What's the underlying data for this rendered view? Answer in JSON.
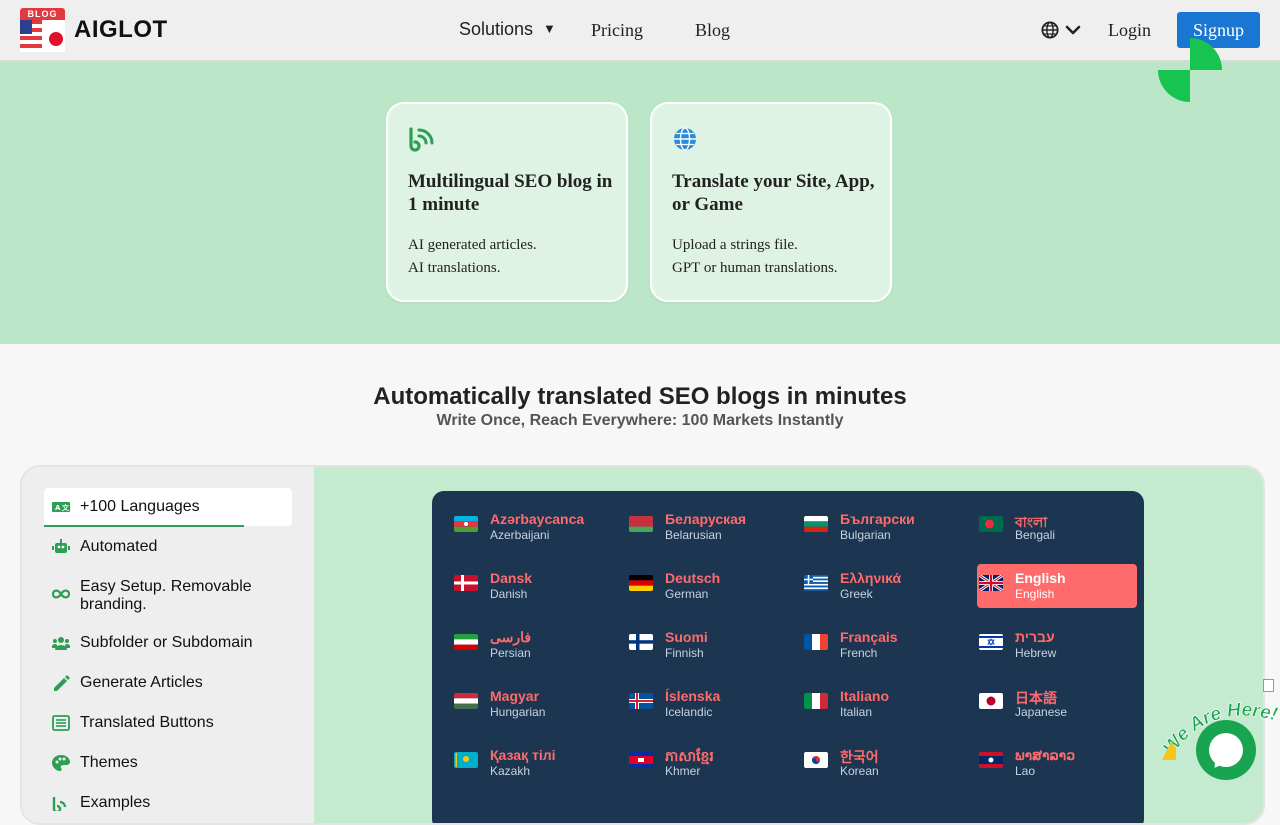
{
  "nav": {
    "logo_tag": "BLOG",
    "brand": "AIGLOT",
    "solutions": "Solutions",
    "solutions_caret": "▼",
    "pricing": "Pricing",
    "blog": "Blog",
    "login": "Login",
    "signup": "Signup",
    "icons": [
      "globe-icon",
      "chevron-down-icon"
    ]
  },
  "hero": {
    "cards": [
      {
        "icon": "blog-feed-icon",
        "title": "Multilingual SEO blog in 1 minute",
        "line1": "AI generated articles.",
        "line2": "AI translations."
      },
      {
        "icon": "globe-icon",
        "title": "Translate your Site, App, or Game",
        "line1": "Upload a strings file.",
        "line2": "GPT or human translations."
      }
    ]
  },
  "section": {
    "title": "Automatically translated SEO blogs in minutes",
    "subtitle": "Write Once, Reach Everywhere: 100 Markets Instantly"
  },
  "sidebar": {
    "items": [
      {
        "icon": "translate-icon",
        "label": "+100 Languages"
      },
      {
        "icon": "robot-icon",
        "label": "Automated"
      },
      {
        "icon": "infinity-icon",
        "label": "Easy Setup. Removable branding."
      },
      {
        "icon": "users-icon",
        "label": "Subfolder or Subdomain"
      },
      {
        "icon": "pencil-icon",
        "label": "Generate Articles"
      },
      {
        "icon": "list-icon",
        "label": "Translated Buttons"
      },
      {
        "icon": "palette-icon",
        "label": "Themes"
      },
      {
        "icon": "feed-icon",
        "label": "Examples"
      }
    ]
  },
  "languages": [
    {
      "native": "Azərbaycanca",
      "english": "Azerbaijani"
    },
    {
      "native": "Беларуская",
      "english": "Belarusian"
    },
    {
      "native": "Български",
      "english": "Bulgarian"
    },
    {
      "native": "বাংলা",
      "english": "Bengali"
    },
    {
      "native": "Dansk",
      "english": "Danish"
    },
    {
      "native": "Deutsch",
      "english": "German"
    },
    {
      "native": "Ελληνικά",
      "english": "Greek"
    },
    {
      "native": "English",
      "english": "English"
    },
    {
      "native": "فارسی",
      "english": "Persian"
    },
    {
      "native": "Suomi",
      "english": "Finnish"
    },
    {
      "native": "Français",
      "english": "French"
    },
    {
      "native": "עברית",
      "english": "Hebrew"
    },
    {
      "native": "Magyar",
      "english": "Hungarian"
    },
    {
      "native": "Íslenska",
      "english": "Icelandic"
    },
    {
      "native": "Italiano",
      "english": "Italian"
    },
    {
      "native": "日本語",
      "english": "Japanese"
    },
    {
      "native": "Қазақ тілі",
      "english": "Kazakh"
    },
    {
      "native": "ភាសាខ្មែរ",
      "english": "Khmer"
    },
    {
      "native": "한국어",
      "english": "Korean"
    },
    {
      "native": "ພາສາລາວ",
      "english": "Lao"
    }
  ],
  "selected_language": "English",
  "chat": {
    "badge": "We Are Here!",
    "icon": "chat-icon"
  },
  "colors": {
    "accent": "#1976d2",
    "green": "#2e9e56",
    "coral": "#ff6b6b",
    "navy": "#1c3550"
  }
}
